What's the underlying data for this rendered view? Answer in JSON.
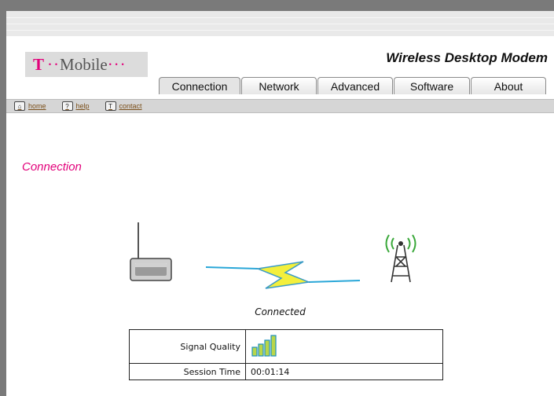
{
  "brand": {
    "logo_t": "T",
    "logo_dots_left": "··",
    "logo_word": "Mobile",
    "logo_dots_right": "···",
    "color": "#e2007a"
  },
  "app": {
    "title": "Wireless Desktop Modem"
  },
  "tabs": [
    {
      "label": "Connection",
      "active": true
    },
    {
      "label": "Network",
      "active": false
    },
    {
      "label": "Advanced",
      "active": false
    },
    {
      "label": "Software",
      "active": false
    },
    {
      "label": "About",
      "active": false
    }
  ],
  "toolbar": {
    "home": {
      "label": "home",
      "icon": "home-icon"
    },
    "help": {
      "label": "help",
      "icon": "help-icon"
    },
    "contact": {
      "label": "contact",
      "icon": "t-mobile-icon"
    }
  },
  "section": {
    "title": "Connection"
  },
  "connection": {
    "status": "Connected",
    "signal_label": "Signal Quality",
    "signal_bars": 4,
    "session_label": "Session Time",
    "session_time": "00:01:14"
  }
}
